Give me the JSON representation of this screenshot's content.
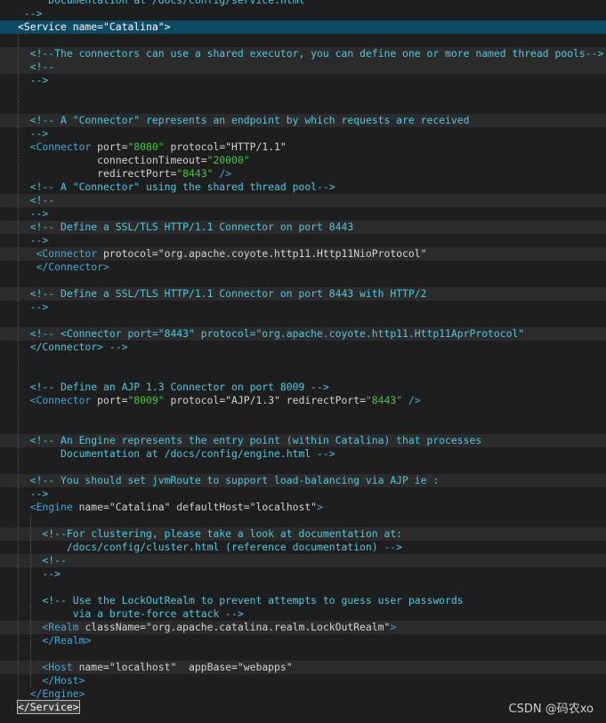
{
  "editor": {
    "lines": [
      {
        "indent": 0,
        "tokens": [
          {
            "t": "comment",
            "v": "     Documentation at /docs/config/service.html"
          }
        ]
      },
      {
        "indent": 0,
        "tokens": [
          {
            "t": "comment",
            "v": " -->"
          }
        ]
      },
      {
        "indent": 0,
        "sel": true,
        "tokens": [
          {
            "t": "select",
            "v": "<Service name=\"Catalina\">"
          }
        ]
      },
      {
        "indent": 1,
        "tokens": []
      },
      {
        "indent": 1,
        "hl": true,
        "tokens": [
          {
            "t": "comment",
            "v": "  <!--The connectors can use a shared executor, you can define one or more named thread pools-->"
          }
        ]
      },
      {
        "indent": 1,
        "hl": true,
        "tokens": [
          {
            "t": "comment",
            "v": "  <!--"
          }
        ]
      },
      {
        "indent": 1,
        "tokens": [
          {
            "t": "comment",
            "v": "  -->"
          }
        ]
      },
      {
        "indent": 1,
        "tokens": []
      },
      {
        "indent": 1,
        "tokens": []
      },
      {
        "indent": 1,
        "hl": true,
        "tokens": [
          {
            "t": "comment",
            "v": "  <!-- A \"Connector\" represents an endpoint by which requests are received"
          }
        ]
      },
      {
        "indent": 1,
        "tokens": [
          {
            "t": "comment",
            "v": "  -->"
          }
        ]
      },
      {
        "indent": 1,
        "tokens": [
          {
            "t": "tag",
            "v": "  <Connector "
          },
          {
            "t": "attr",
            "v": "port="
          },
          {
            "t": "value",
            "v": "\"8080\""
          },
          {
            "t": "attr",
            "v": " protocol="
          },
          {
            "t": "text",
            "v": "\"HTTP/1.1\""
          }
        ]
      },
      {
        "indent": 1,
        "tokens": [
          {
            "t": "attr",
            "v": "             connectionTimeout="
          },
          {
            "t": "value",
            "v": "\"20000\""
          }
        ]
      },
      {
        "indent": 1,
        "tokens": [
          {
            "t": "attr",
            "v": "             redirectPort="
          },
          {
            "t": "value",
            "v": "\"8443\""
          },
          {
            "t": "tag",
            "v": " />"
          }
        ]
      },
      {
        "indent": 1,
        "tokens": [
          {
            "t": "comment",
            "v": "  <!-- A \"Connector\" using the shared thread pool-->"
          }
        ]
      },
      {
        "indent": 1,
        "hl": true,
        "tokens": [
          {
            "t": "comment",
            "v": "  <!--"
          }
        ]
      },
      {
        "indent": 1,
        "tokens": [
          {
            "t": "comment",
            "v": "  -->"
          }
        ]
      },
      {
        "indent": 1,
        "hl": true,
        "tokens": [
          {
            "t": "comment",
            "v": "  <!-- Define a SSL/TLS HTTP/1.1 Connector on port 8443"
          }
        ]
      },
      {
        "indent": 1,
        "tokens": [
          {
            "t": "comment",
            "v": "  -->"
          }
        ]
      },
      {
        "indent": 1,
        "hl": true,
        "tokens": [
          {
            "t": "tag",
            "v": "   <Connector "
          },
          {
            "t": "attr",
            "v": "protocol="
          },
          {
            "t": "text",
            "v": "\"org.apache.coyote.http11.Http11NioProtocol\""
          }
        ]
      },
      {
        "indent": 1,
        "tokens": [
          {
            "t": "tag",
            "v": "   </Connector>"
          }
        ]
      },
      {
        "indent": 1,
        "tokens": []
      },
      {
        "indent": 1,
        "hl": true,
        "tokens": [
          {
            "t": "comment",
            "v": "  <!-- Define a SSL/TLS HTTP/1.1 Connector on port 8443 with HTTP/2"
          }
        ]
      },
      {
        "indent": 1,
        "tokens": [
          {
            "t": "comment",
            "v": "  -->"
          }
        ]
      },
      {
        "indent": 1,
        "tokens": []
      },
      {
        "indent": 1,
        "hl": true,
        "tokens": [
          {
            "t": "comment",
            "v": "  <!-- <Connector port=\"8443\" protocol=\"org.apache.coyote.http11.Http11AprProtocol\""
          }
        ]
      },
      {
        "indent": 1,
        "tokens": [
          {
            "t": "comment",
            "v": "  </Connector> -->"
          }
        ]
      },
      {
        "indent": 1,
        "tokens": []
      },
      {
        "indent": 1,
        "tokens": []
      },
      {
        "indent": 1,
        "tokens": [
          {
            "t": "comment",
            "v": "  <!-- Define an AJP 1.3 Connector on port 8009 -->"
          }
        ]
      },
      {
        "indent": 1,
        "tokens": [
          {
            "t": "tag",
            "v": "  <Connector "
          },
          {
            "t": "attr",
            "v": "port="
          },
          {
            "t": "value",
            "v": "\"8009\""
          },
          {
            "t": "attr",
            "v": " protocol="
          },
          {
            "t": "text",
            "v": "\"AJP/1.3\""
          },
          {
            "t": "attr",
            "v": " redirectPort="
          },
          {
            "t": "value",
            "v": "\"8443\""
          },
          {
            "t": "tag",
            "v": " />"
          }
        ]
      },
      {
        "indent": 1,
        "tokens": []
      },
      {
        "indent": 1,
        "tokens": []
      },
      {
        "indent": 1,
        "hl": true,
        "tokens": [
          {
            "t": "comment",
            "v": "  <!-- An Engine represents the entry point (within Catalina) that processes"
          }
        ]
      },
      {
        "indent": 1,
        "tokens": [
          {
            "t": "comment",
            "v": "       Documentation at /docs/config/engine.html -->"
          }
        ]
      },
      {
        "indent": 1,
        "tokens": []
      },
      {
        "indent": 1,
        "hl": true,
        "tokens": [
          {
            "t": "comment",
            "v": "  <!-- You should set jvmRoute to support load-balancing via AJP ie :"
          }
        ]
      },
      {
        "indent": 1,
        "tokens": [
          {
            "t": "comment",
            "v": "  -->"
          }
        ]
      },
      {
        "indent": 1,
        "tokens": [
          {
            "t": "tag",
            "v": "  <Engine "
          },
          {
            "t": "attr",
            "v": "name="
          },
          {
            "t": "text",
            "v": "\"Catalina\""
          },
          {
            "t": "attr",
            "v": " defaultHost="
          },
          {
            "t": "text",
            "v": "\"localhost\""
          },
          {
            "t": "tag",
            "v": ">"
          }
        ]
      },
      {
        "indent": 2,
        "tokens": []
      },
      {
        "indent": 2,
        "hl": true,
        "tokens": [
          {
            "t": "comment",
            "v": "    <!--For clustering, please take a look at documentation at:"
          }
        ]
      },
      {
        "indent": 2,
        "tokens": [
          {
            "t": "comment",
            "v": "        /docs/config/cluster.html (reference documentation) -->"
          }
        ]
      },
      {
        "indent": 2,
        "hl": true,
        "tokens": [
          {
            "t": "comment",
            "v": "    <!--"
          }
        ]
      },
      {
        "indent": 2,
        "tokens": [
          {
            "t": "comment",
            "v": "    -->"
          }
        ]
      },
      {
        "indent": 2,
        "tokens": []
      },
      {
        "indent": 2,
        "tokens": [
          {
            "t": "comment",
            "v": "    <!-- Use the LockOutRealm to prevent attempts to guess user passwords"
          }
        ]
      },
      {
        "indent": 2,
        "tokens": [
          {
            "t": "comment",
            "v": "         via a brute-force attack -->"
          }
        ]
      },
      {
        "indent": 2,
        "hl": true,
        "tokens": [
          {
            "t": "tag",
            "v": "    <Realm "
          },
          {
            "t": "attr",
            "v": "className="
          },
          {
            "t": "text",
            "v": "\"org.apache.catalina.realm.LockOutRealm\""
          },
          {
            "t": "tag",
            "v": ">"
          }
        ]
      },
      {
        "indent": 2,
        "tokens": [
          {
            "t": "tag",
            "v": "    </Realm>"
          }
        ]
      },
      {
        "indent": 2,
        "tokens": []
      },
      {
        "indent": 2,
        "hl": true,
        "tokens": [
          {
            "t": "tag",
            "v": "    <Host "
          },
          {
            "t": "attr",
            "v": "name="
          },
          {
            "t": "text",
            "v": "\"localhost\""
          },
          {
            "t": "attr",
            "v": "  appBase="
          },
          {
            "t": "text",
            "v": "\"webapps\""
          }
        ]
      },
      {
        "indent": 2,
        "tokens": [
          {
            "t": "tag",
            "v": "    </Host>"
          }
        ]
      },
      {
        "indent": 1,
        "tokens": [
          {
            "t": "tag",
            "v": "  </Engine>"
          }
        ]
      },
      {
        "indent": 0,
        "tokens": [
          {
            "t": "select-box",
            "v": "</Service>"
          }
        ]
      }
    ]
  },
  "watermark": "CSDN @码农xo"
}
